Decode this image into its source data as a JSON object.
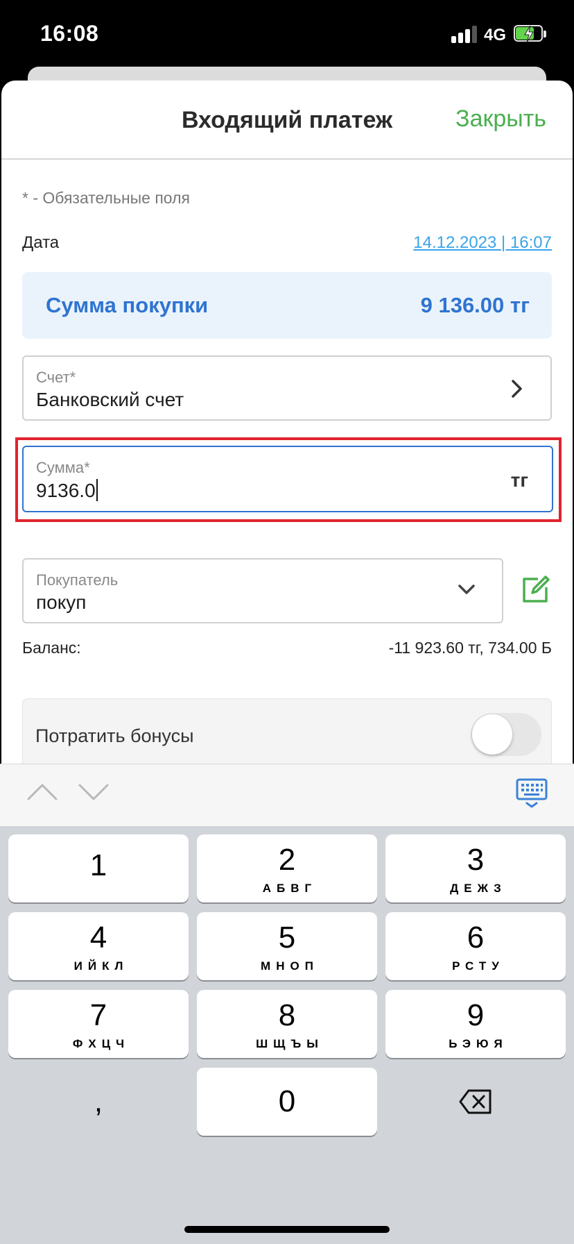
{
  "status_bar": {
    "time": "16:08",
    "network": "4G"
  },
  "header": {
    "title": "Входящий платеж",
    "close_label": "Закрыть"
  },
  "form": {
    "required_hint": "* - Обязательные поля",
    "date": {
      "label": "Дата",
      "value": "14.12.2023 | 16:07"
    },
    "purchase_sum": {
      "label": "Сумма покупки",
      "value": "9 136.00  тг"
    },
    "account": {
      "label": "Счет*",
      "value": "Банковский счет"
    },
    "amount": {
      "label": "Сумма*",
      "value": "9136.0",
      "currency": "тг"
    },
    "buyer": {
      "label": "Покупатель",
      "value": "покуп"
    },
    "balance": {
      "label": "Баланс:",
      "value": "-11 923.60 тг, 734.00 Б"
    },
    "bonus": {
      "label": "Потратить бонусы",
      "enabled": false
    }
  },
  "keyboard": {
    "keys": [
      {
        "num": "1",
        "letters": ""
      },
      {
        "num": "2",
        "letters": "АБВГ"
      },
      {
        "num": "3",
        "letters": "ДЕЖЗ"
      },
      {
        "num": "4",
        "letters": "ИЙКЛ"
      },
      {
        "num": "5",
        "letters": "МНОП"
      },
      {
        "num": "6",
        "letters": "РСТУ"
      },
      {
        "num": "7",
        "letters": "ФХЦЧ"
      },
      {
        "num": "8",
        "letters": "ШЩЪЫ"
      },
      {
        "num": "9",
        "letters": "ЬЭЮЯ"
      },
      {
        "num": "0",
        "letters": ""
      }
    ],
    "comma": ","
  },
  "colors": {
    "accent_green": "#4caf50",
    "accent_blue": "#2f74d0",
    "highlight_red": "#e0242e"
  }
}
